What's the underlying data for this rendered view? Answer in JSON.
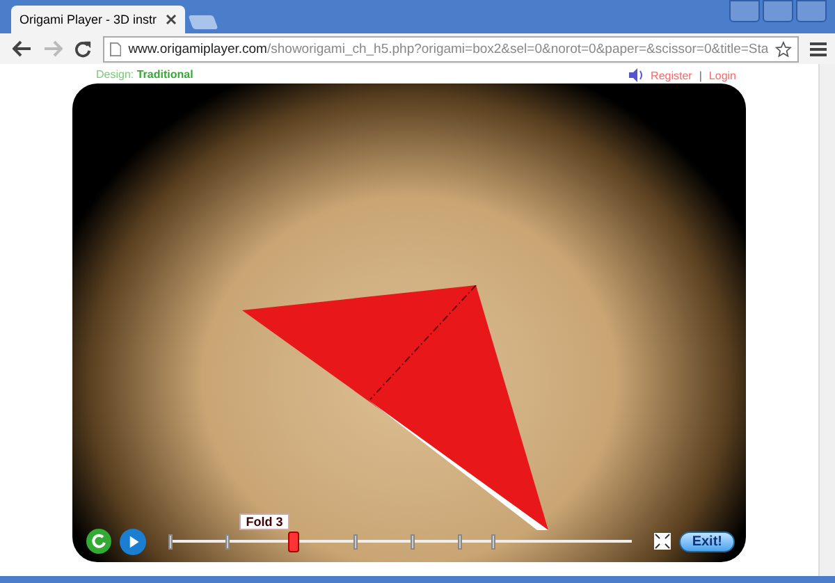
{
  "browser": {
    "tab_title": "Origami Player - 3D instr",
    "url_domain": "www.origamiplayer.com",
    "url_path": "/showorigami_ch_h5.php?origami=box2&sel=0&norot=0&paper=&scissor=0&title=Sta"
  },
  "header": {
    "design_label": "Design:",
    "design_value": "Traditional",
    "register": "Register",
    "separator": "|",
    "login": "Login"
  },
  "player": {
    "step_label": "Fold 3",
    "slider": {
      "level": 0.26
    },
    "exit": "Exit!"
  }
}
